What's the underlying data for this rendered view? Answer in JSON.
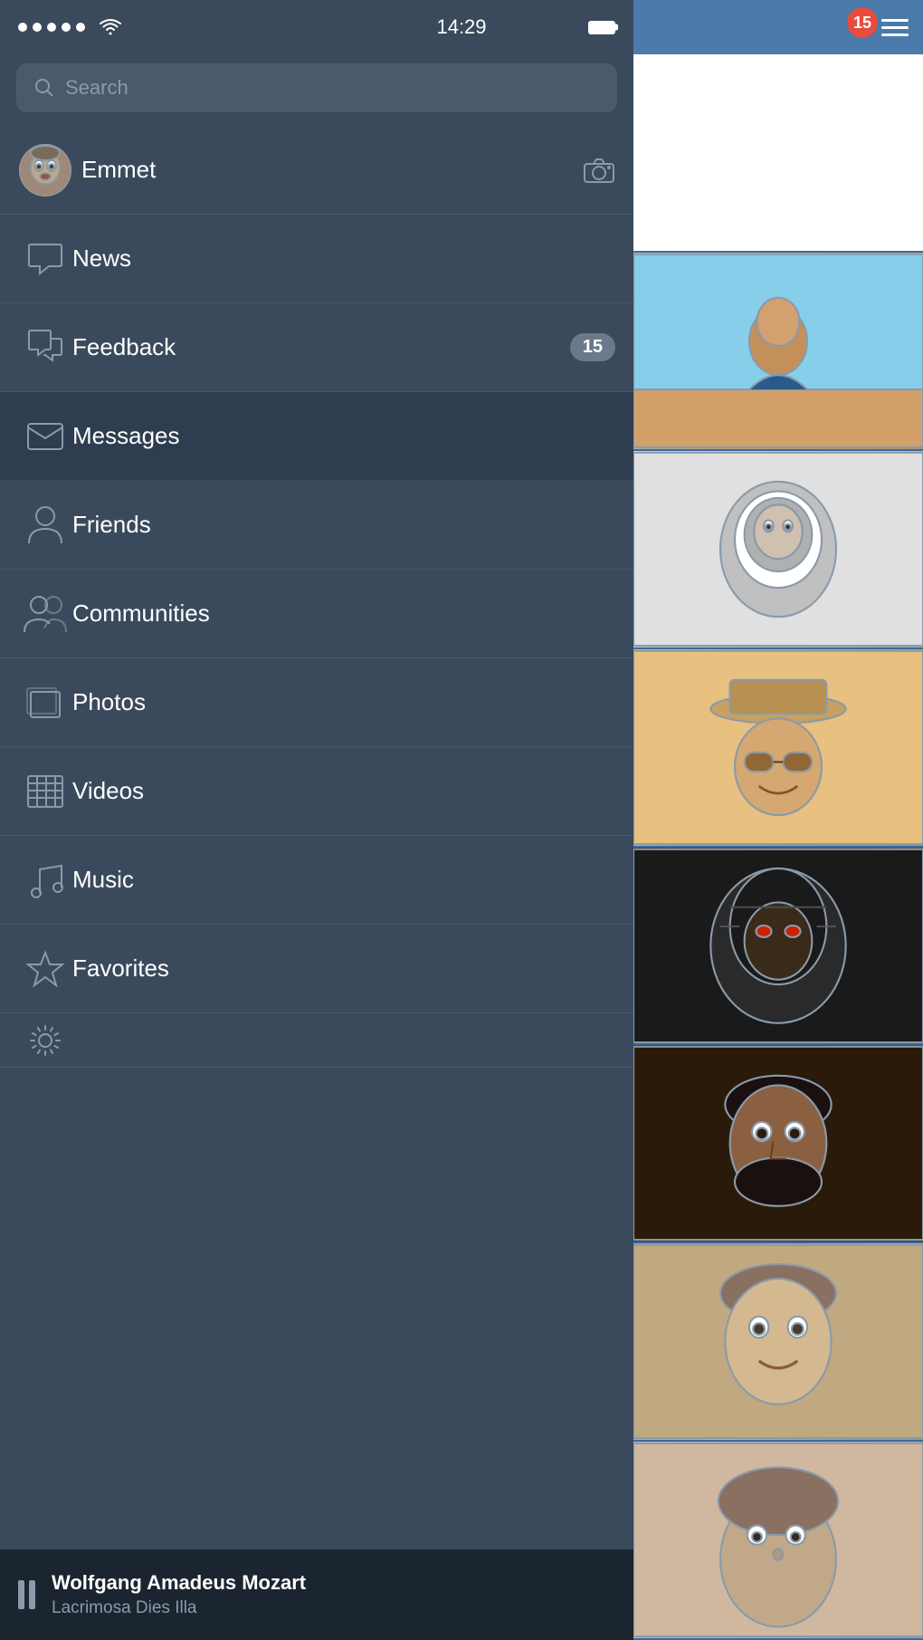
{
  "statusBar": {
    "time": "14:29",
    "dots": 5,
    "wifi": true,
    "battery": true
  },
  "search": {
    "placeholder": "Search"
  },
  "user": {
    "name": "Emmet"
  },
  "menuItems": [
    {
      "id": "news",
      "label": "News",
      "icon": "chat-icon",
      "badge": null,
      "active": false
    },
    {
      "id": "feedback",
      "label": "Feedback",
      "icon": "chat-bubble-icon",
      "badge": "15",
      "active": false
    },
    {
      "id": "messages",
      "label": "Messages",
      "icon": "mail-icon",
      "badge": null,
      "active": true
    },
    {
      "id": "friends",
      "label": "Friends",
      "icon": "person-icon",
      "badge": null,
      "active": false
    },
    {
      "id": "communities",
      "label": "Communities",
      "icon": "people-icon",
      "badge": null,
      "active": false
    },
    {
      "id": "photos",
      "label": "Photos",
      "icon": "photos-icon",
      "badge": null,
      "active": false
    },
    {
      "id": "videos",
      "label": "Videos",
      "icon": "video-icon",
      "badge": null,
      "active": false
    },
    {
      "id": "music",
      "label": "Music",
      "icon": "music-icon",
      "badge": null,
      "active": false
    },
    {
      "id": "favorites",
      "label": "Favorites",
      "icon": "star-icon",
      "badge": null,
      "active": false
    },
    {
      "id": "settings",
      "label": "Settings",
      "icon": "gear-icon",
      "badge": null,
      "active": false
    }
  ],
  "musicPlayer": {
    "title": "Wolfgang Amadeus Mozart",
    "subtitle": "Lacrimosa Dies Illa"
  },
  "rightPanel": {
    "notifBadge": "15",
    "feedItems": [
      {
        "id": "feed-1",
        "type": "white"
      },
      {
        "id": "feed-2",
        "type": "face-1"
      },
      {
        "id": "feed-3",
        "type": "face-2"
      },
      {
        "id": "feed-4",
        "type": "face-3"
      },
      {
        "id": "feed-5",
        "type": "face-4"
      },
      {
        "id": "feed-6",
        "type": "face-5"
      },
      {
        "id": "feed-7",
        "type": "face-6"
      },
      {
        "id": "feed-8",
        "type": "face-7"
      }
    ]
  }
}
